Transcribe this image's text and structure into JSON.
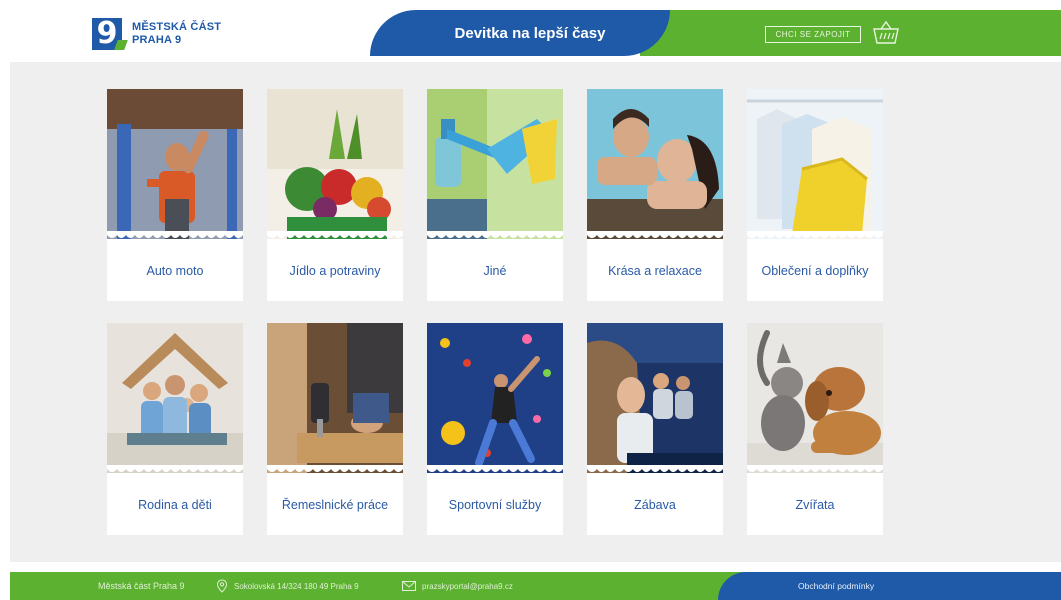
{
  "header": {
    "logo_mark": "9",
    "logo_line1": "MĚSTSKÁ ČÁST",
    "logo_line2": "PRAHA 9",
    "title": "Devitka na lepší časy",
    "login_label": "CHCI SE ZAPOJIT",
    "basket_icon": "basket-icon"
  },
  "categories": [
    {
      "label": "Auto moto"
    },
    {
      "label": "Jídlo a potraviny"
    },
    {
      "label": "Jiné"
    },
    {
      "label": "Krása a relaxace"
    },
    {
      "label": "Oblečení a doplňky"
    },
    {
      "label": "Rodina a děti"
    },
    {
      "label": "Řemeslnické práce"
    },
    {
      "label": "Sportovní služby"
    },
    {
      "label": "Zábava"
    },
    {
      "label": "Zvířata"
    }
  ],
  "footer": {
    "org": "Městská část Praha 9",
    "address": "Sokolovská 14/324 180 49 Praha 9",
    "email": "prazskyportal@praha9.cz",
    "terms": "Obchodní podmínky"
  },
  "colors": {
    "brand_blue": "#1e5aa8",
    "brand_green": "#5db130",
    "background": "#efefef"
  }
}
